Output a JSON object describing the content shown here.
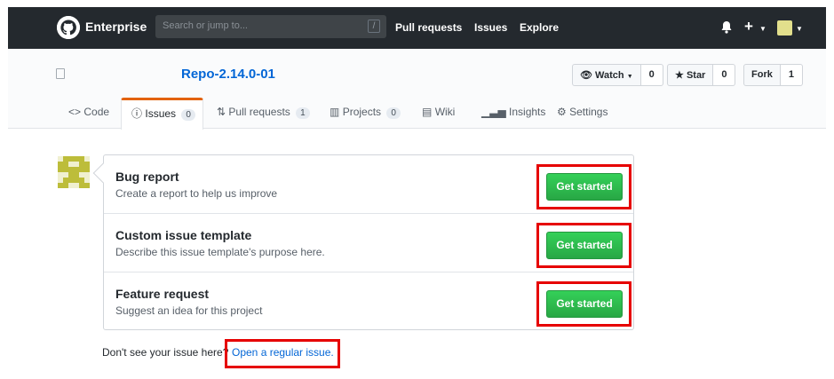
{
  "header": {
    "brand": "Enterprise",
    "search_placeholder": "Search or jump to...",
    "search_shortcut": "/",
    "nav": [
      "Pull requests",
      "Issues",
      "Explore"
    ],
    "plus_label": "+"
  },
  "repo": {
    "name": "Repo-2.14.0-01",
    "watch_label": "Watch",
    "watch_count": "0",
    "star_label": "Star",
    "star_count": "0",
    "fork_label": "Fork",
    "fork_count": "1"
  },
  "tabs": [
    {
      "label": "Code",
      "count": ""
    },
    {
      "label": "Issues",
      "count": "0"
    },
    {
      "label": "Pull requests",
      "count": "1"
    },
    {
      "label": "Projects",
      "count": "0"
    },
    {
      "label": "Wiki",
      "count": ""
    },
    {
      "label": "Insights",
      "count": ""
    },
    {
      "label": "Settings",
      "count": ""
    }
  ],
  "templates": [
    {
      "title": "Bug report",
      "description": "Create a report to help us improve",
      "button": "Get started"
    },
    {
      "title": "Custom issue template",
      "description": "Describe this issue template's purpose here.",
      "button": "Get started"
    },
    {
      "title": "Feature request",
      "description": "Suggest an idea for this project",
      "button": "Get started"
    }
  ],
  "footer": {
    "note": "Don't see your issue here?",
    "link": "Open a regular issue."
  },
  "colors": {
    "header_bg": "#24292e",
    "link": "#0366d6",
    "button_green": "#28a745",
    "annotation_red": "#e60000",
    "selected_tab_accent": "#e36209"
  }
}
